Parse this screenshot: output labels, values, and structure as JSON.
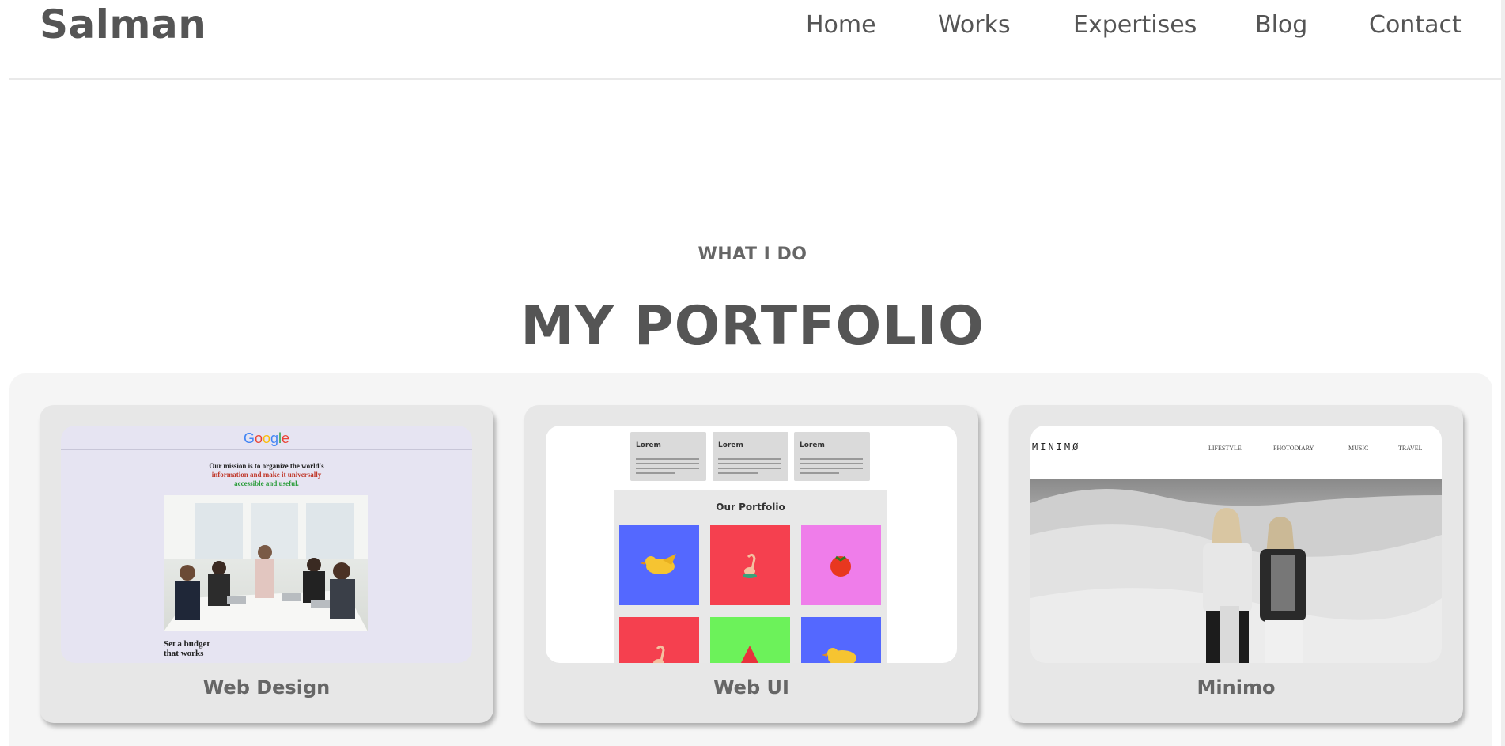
{
  "header": {
    "logo": "Salman",
    "nav": [
      "Home",
      "Works",
      "Expertises",
      "Blog",
      "Contact"
    ]
  },
  "section": {
    "eyebrow": "WHAT I DO",
    "title": "MY PORTFOLIO"
  },
  "cards": [
    {
      "label": "Web Design",
      "thumb": {
        "logo": "Google",
        "mission_line1": "Our mission is to organize the world's",
        "mission_line2": "information and make it universally",
        "mission_line3": "accessible and useful.",
        "budget_line1": "Set a budget",
        "budget_line2": "that works"
      }
    },
    {
      "label": "Web UI",
      "thumb": {
        "lorem": [
          "Lorem",
          "Lorem",
          "Lorem"
        ],
        "portfolio_title": "Our Portfolio"
      }
    },
    {
      "label": "Minimo",
      "thumb": {
        "brand": "MINIMØ",
        "nav": [
          "LIFESTYLE",
          "PHOTODIARY",
          "MUSIC",
          "TRAVEL"
        ]
      }
    }
  ],
  "colors": {
    "text": "#555555",
    "panel": "#f5f5f5",
    "card": "#e7e7e7",
    "tile_blue": "#5468ff",
    "tile_red": "#f5404f",
    "tile_pink": "#ef7dea",
    "tile_green": "#6cf25a"
  }
}
